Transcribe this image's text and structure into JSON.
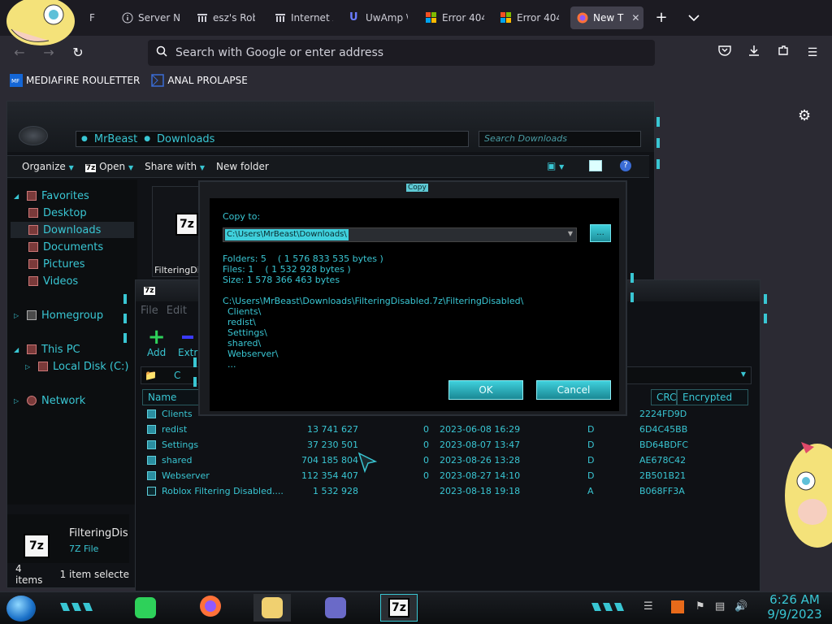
{
  "browser": {
    "tabs": [
      {
        "label": "F",
        "icon": "sticker-icon",
        "active": false
      },
      {
        "label": "Server Ne",
        "icon": "info-icon",
        "active": false
      },
      {
        "label": "esz's Robl",
        "icon": "archive-icon",
        "active": false
      },
      {
        "label": "Internet A",
        "icon": "archive-icon",
        "active": false
      },
      {
        "label": "UwAmp \\",
        "icon": "uwamp-icon",
        "active": false
      },
      {
        "label": "Error 404",
        "icon": "microsoft-icon",
        "active": false
      },
      {
        "label": "Error 404",
        "icon": "microsoft-icon",
        "active": false
      },
      {
        "label": "New T",
        "icon": "firefox-icon",
        "active": true
      }
    ],
    "new_tab_symbol": "+",
    "tab_close_symbol": "✕",
    "url_placeholder": "Search with Google or enter address",
    "bookmarks": [
      {
        "label": "MEDIAFIRE ROULETTER",
        "icon": "mediafire-icon"
      },
      {
        "label": "ANAL PROLAPSE",
        "icon": "bookmark-icon"
      }
    ]
  },
  "explorer": {
    "breadcrumb": [
      "MrBeast",
      "Downloads"
    ],
    "search_placeholder": "Search Downloads",
    "commands": {
      "organize": "Organize",
      "open": "Open",
      "share_with": "Share with",
      "new_folder": "New folder"
    },
    "nav": {
      "favorites": "Favorites",
      "desktop": "Desktop",
      "downloads": "Downloads",
      "documents": "Documents",
      "pictures": "Pictures",
      "videos": "Videos",
      "homegroup": "Homegroup",
      "this_pc": "This PC",
      "local_disk": "Local Disk (C:)",
      "network": "Network"
    },
    "file_tile_label": "FilteringDis",
    "thumb_label": "7z",
    "details": {
      "name": "FilteringDis",
      "type": "7Z File"
    },
    "status": {
      "items": "4 items",
      "selected": "1 item selecte"
    }
  },
  "zip": {
    "icon_label": "7z",
    "menu": {
      "file": "File",
      "edit": "Edit"
    },
    "tools": {
      "add": "Add",
      "extract": "Extr"
    },
    "path_fragment": "C",
    "columns": {
      "name": "Name",
      "crc": "CRC",
      "encrypted": "Encrypted"
    },
    "rows": [
      {
        "name": "Clients",
        "size": "",
        "packed": "",
        "modified": "",
        "attr": "",
        "crc": "2224FD9D"
      },
      {
        "name": "redist",
        "size": "13 741 627",
        "packed": "0",
        "modified": "2023-06-08 16:29",
        "attr": "D",
        "crc": "6D4C45BB"
      },
      {
        "name": "Settings",
        "size": "37 230 501",
        "packed": "0",
        "modified": "2023-08-07 13:47",
        "attr": "D",
        "crc": "BD64BDFC"
      },
      {
        "name": "shared",
        "size": "704 185 804",
        "packed": "0",
        "modified": "2023-08-26 13:28",
        "attr": "D",
        "crc": "AE678C42"
      },
      {
        "name": "Webserver",
        "size": "112 354 407",
        "packed": "0",
        "modified": "2023-08-27 14:10",
        "attr": "D",
        "crc": "2B501B21"
      },
      {
        "name": "Roblox Filtering Disabled....",
        "size": "1 532 928",
        "packed": "",
        "modified": "2023-08-18 19:18",
        "attr": "A",
        "crc": "B068FF3A"
      }
    ]
  },
  "copy_dialog": {
    "title": "Copy",
    "copy_to_label": "Copy to:",
    "destination": "C:\\Users\\MrBeast\\Downloads\\",
    "browse_label": "...",
    "folders_line": "Folders: 5    ( 1 576 833 535 bytes )",
    "files_line": "Files: 1    ( 1 532 928 bytes )",
    "size_line": "Size: 1 578 366 463 bytes",
    "source_path": "C:\\Users\\MrBeast\\Downloads\\FilteringDisabled.7z\\FilteringDisabled\\",
    "source_items": [
      "Clients\\",
      "redist\\",
      "Settings\\",
      "shared\\",
      "Webserver\\",
      "..."
    ],
    "ok_label": "OK",
    "cancel_label": "Cancel"
  },
  "taskbar": {
    "apps": [
      "notes-icon",
      "firefox-icon",
      "file-explorer-icon",
      "control-panel-icon",
      "7zip-icon"
    ],
    "zip_label": "7z",
    "clock_time": "6:26 AM",
    "clock_date": "9/9/2023"
  },
  "colors": {
    "accent": "#39c6d3",
    "browser_bg": "#2b2a33",
    "tab_bg": "#1c1b22"
  }
}
